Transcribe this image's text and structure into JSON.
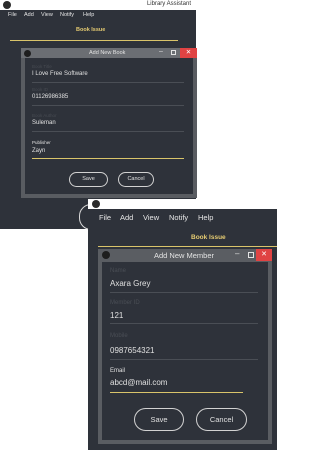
{
  "colors": {
    "background": "#2e323a",
    "accent": "#d9c46a",
    "tab_text": "#e6cc72",
    "close": "#e04343"
  },
  "menu": [
    "File",
    "Add",
    "View",
    "Notify",
    "Help"
  ],
  "window1": {
    "app_title": "Library Assistant",
    "tab_label": "Book Issue",
    "dialog": {
      "title": "Add New Book",
      "fields": [
        {
          "label": "Book Title",
          "value": "I Love Free Software"
        },
        {
          "label": "Book ID",
          "value": "01126986385"
        },
        {
          "label": "Book Author",
          "value": "Suleman"
        },
        {
          "label": "Publisher",
          "value": "Zayn",
          "active": true
        }
      ],
      "save_label": "Save",
      "cancel_label": "Cancel"
    }
  },
  "window2": {
    "tab_label": "Book Issue",
    "dialog": {
      "title": "Add New Member",
      "fields": [
        {
          "label": "Name",
          "value": "Axara Grey"
        },
        {
          "label": "Member ID",
          "value": "121"
        },
        {
          "label": "Mobile",
          "value": "0987654321"
        },
        {
          "label": "Email",
          "value": "abcd@mail.com",
          "active": true
        }
      ],
      "save_label": "Save",
      "cancel_label": "Cancel"
    }
  }
}
